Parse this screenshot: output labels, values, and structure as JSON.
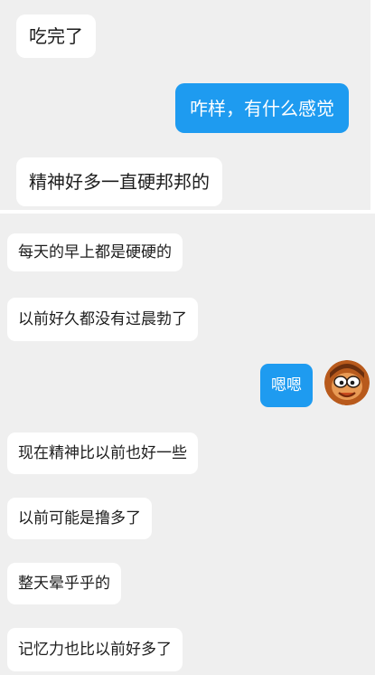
{
  "upper_chat": {
    "messages": [
      {
        "side": "left",
        "text": "吃完了"
      },
      {
        "side": "right",
        "text": "咋样，有什么感觉"
      },
      {
        "side": "left",
        "text": "精神好多一直硬邦邦的"
      }
    ]
  },
  "lower_chat": {
    "messages": [
      {
        "side": "left",
        "text": "每天的早上都是硬硬的"
      },
      {
        "side": "left",
        "text": "以前好久都没有过晨勃了"
      },
      {
        "side": "right",
        "text": "嗯嗯"
      },
      {
        "side": "left",
        "text": "现在精神比以前也好一些"
      },
      {
        "side": "left",
        "text": "以前可能是撸多了"
      },
      {
        "side": "left",
        "text": "整天晕乎乎的"
      },
      {
        "side": "left",
        "text": "记忆力也比以前好多了"
      }
    ],
    "avatar_icon": "cartoon-face-avatar"
  },
  "colors": {
    "chat_background": "#efefef",
    "incoming_bubble": "#ffffff",
    "outgoing_bubble": "#1e9bf0",
    "outgoing_text": "#ffffff"
  }
}
